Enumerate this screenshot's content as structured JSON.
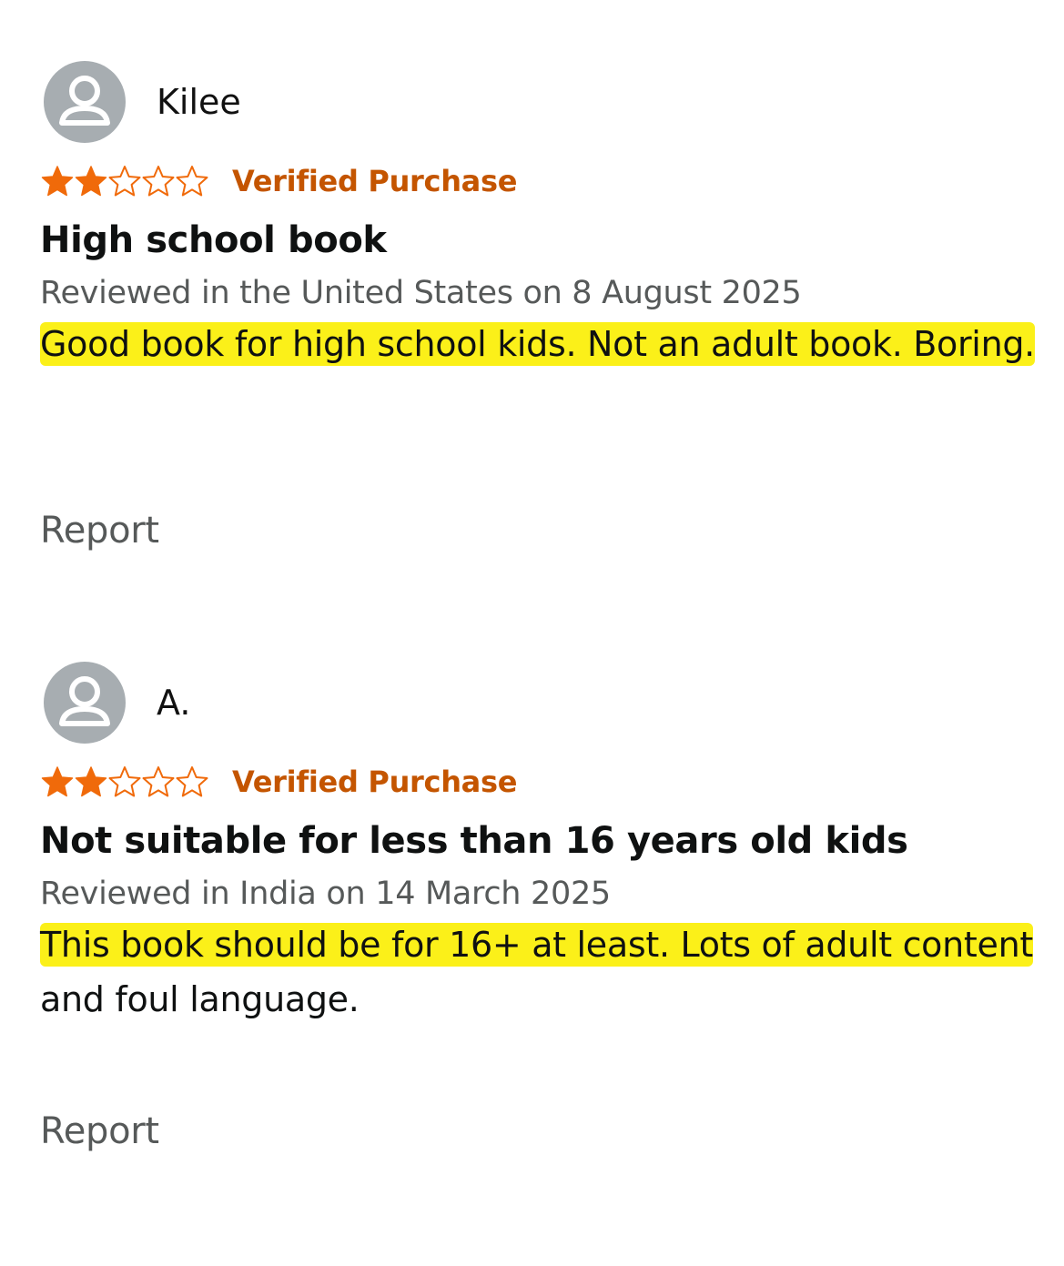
{
  "colors": {
    "star": "#f06a0a",
    "verified": "#c45500",
    "highlight": "#fbf019",
    "meta": "#565959",
    "avatar": "#a7adb1"
  },
  "reviews": [
    {
      "reviewer": "Kilee",
      "rating": 2,
      "max_rating": 5,
      "badge": "Verified Purchase",
      "title": "High school book",
      "meta": "Reviewed in the United States on 8 August 2025",
      "body_highlighted": "Good book for high school kids. Not an adult book. Boring.",
      "body_rest": "",
      "report_label": "Report"
    },
    {
      "reviewer": "A.",
      "rating": 2,
      "max_rating": 5,
      "badge": "Verified Purchase",
      "title": "Not suitable for less than 16 years old kids",
      "meta": "Reviewed in India on 14 March 2025",
      "body_highlighted": "This book should be for 16+ at least. Lots of adult content",
      "body_rest": " and foul language.",
      "report_label": "Report"
    }
  ]
}
